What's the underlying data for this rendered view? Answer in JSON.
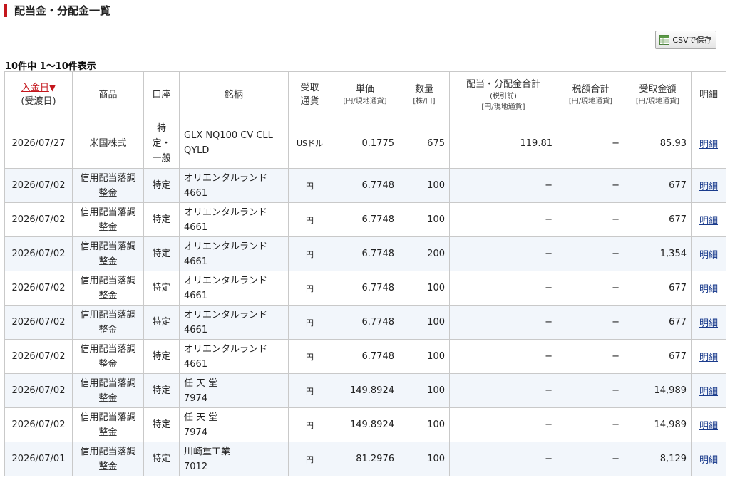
{
  "page": {
    "title": "配当金・分配金一覧",
    "csv_button": "CSVで保存",
    "result_count": "10件中 1〜10件表示"
  },
  "table": {
    "headers": {
      "date_main": "入金日",
      "date_arrow": "▼",
      "date_sub": "(受渡日)",
      "product": "商品",
      "account": "口座",
      "issue": "銘柄",
      "currency_1": "受取",
      "currency_2": "通貨",
      "unit_price": "単価",
      "unit_price_sub": "[円/現地通貨]",
      "quantity": "数量",
      "quantity_sub": "[株/口]",
      "total": "配当・分配金合計",
      "total_sub1": "(税引前)",
      "total_sub2": "[円/現地通貨]",
      "tax": "税額合計",
      "tax_sub": "[円/現地通貨]",
      "received": "受取金額",
      "received_sub": "[円/現地通貨]",
      "detail": "明細"
    },
    "rows": [
      {
        "date": "2026/07/27",
        "product": "米国株式",
        "account": "特定・一般",
        "issue": "GLX NQ100 CV CLL QYLD",
        "code": "",
        "currency": "USドル",
        "unit_price": "0.1775",
        "quantity": "675",
        "total": "119.81",
        "tax": "−",
        "received": "85.93",
        "detail": "明細"
      },
      {
        "date": "2026/07/02",
        "product": "信用配当落調整金",
        "account": "特定",
        "issue": "オリエンタルランド",
        "code": "4661",
        "currency": "円",
        "unit_price": "6.7748",
        "quantity": "100",
        "total": "−",
        "tax": "−",
        "received": "677",
        "detail": "明細"
      },
      {
        "date": "2026/07/02",
        "product": "信用配当落調整金",
        "account": "特定",
        "issue": "オリエンタルランド",
        "code": "4661",
        "currency": "円",
        "unit_price": "6.7748",
        "quantity": "100",
        "total": "−",
        "tax": "−",
        "received": "677",
        "detail": "明細"
      },
      {
        "date": "2026/07/02",
        "product": "信用配当落調整金",
        "account": "特定",
        "issue": "オリエンタルランド",
        "code": "4661",
        "currency": "円",
        "unit_price": "6.7748",
        "quantity": "200",
        "total": "−",
        "tax": "−",
        "received": "1,354",
        "detail": "明細"
      },
      {
        "date": "2026/07/02",
        "product": "信用配当落調整金",
        "account": "特定",
        "issue": "オリエンタルランド",
        "code": "4661",
        "currency": "円",
        "unit_price": "6.7748",
        "quantity": "100",
        "total": "−",
        "tax": "−",
        "received": "677",
        "detail": "明細"
      },
      {
        "date": "2026/07/02",
        "product": "信用配当落調整金",
        "account": "特定",
        "issue": "オリエンタルランド",
        "code": "4661",
        "currency": "円",
        "unit_price": "6.7748",
        "quantity": "100",
        "total": "−",
        "tax": "−",
        "received": "677",
        "detail": "明細"
      },
      {
        "date": "2026/07/02",
        "product": "信用配当落調整金",
        "account": "特定",
        "issue": "オリエンタルランド",
        "code": "4661",
        "currency": "円",
        "unit_price": "6.7748",
        "quantity": "100",
        "total": "−",
        "tax": "−",
        "received": "677",
        "detail": "明細"
      },
      {
        "date": "2026/07/02",
        "product": "信用配当落調整金",
        "account": "特定",
        "issue": "任 天 堂",
        "code": "7974",
        "currency": "円",
        "unit_price": "149.8924",
        "quantity": "100",
        "total": "−",
        "tax": "−",
        "received": "14,989",
        "detail": "明細"
      },
      {
        "date": "2026/07/02",
        "product": "信用配当落調整金",
        "account": "特定",
        "issue": "任 天 堂",
        "code": "7974",
        "currency": "円",
        "unit_price": "149.8924",
        "quantity": "100",
        "total": "−",
        "tax": "−",
        "received": "14,989",
        "detail": "明細"
      },
      {
        "date": "2026/07/01",
        "product": "信用配当落調整金",
        "account": "特定",
        "issue": "川崎重工業",
        "code": "7012",
        "currency": "円",
        "unit_price": "81.2976",
        "quantity": "100",
        "total": "−",
        "tax": "−",
        "received": "8,129",
        "detail": "明細"
      }
    ]
  },
  "colors": {
    "accent_red": "#c4161c",
    "link_blue": "#1a3b8c",
    "row_alt": "#f2f6fb"
  },
  "icons": {
    "csv": "spreadsheet-icon",
    "sort": "sort-down-triangle"
  }
}
